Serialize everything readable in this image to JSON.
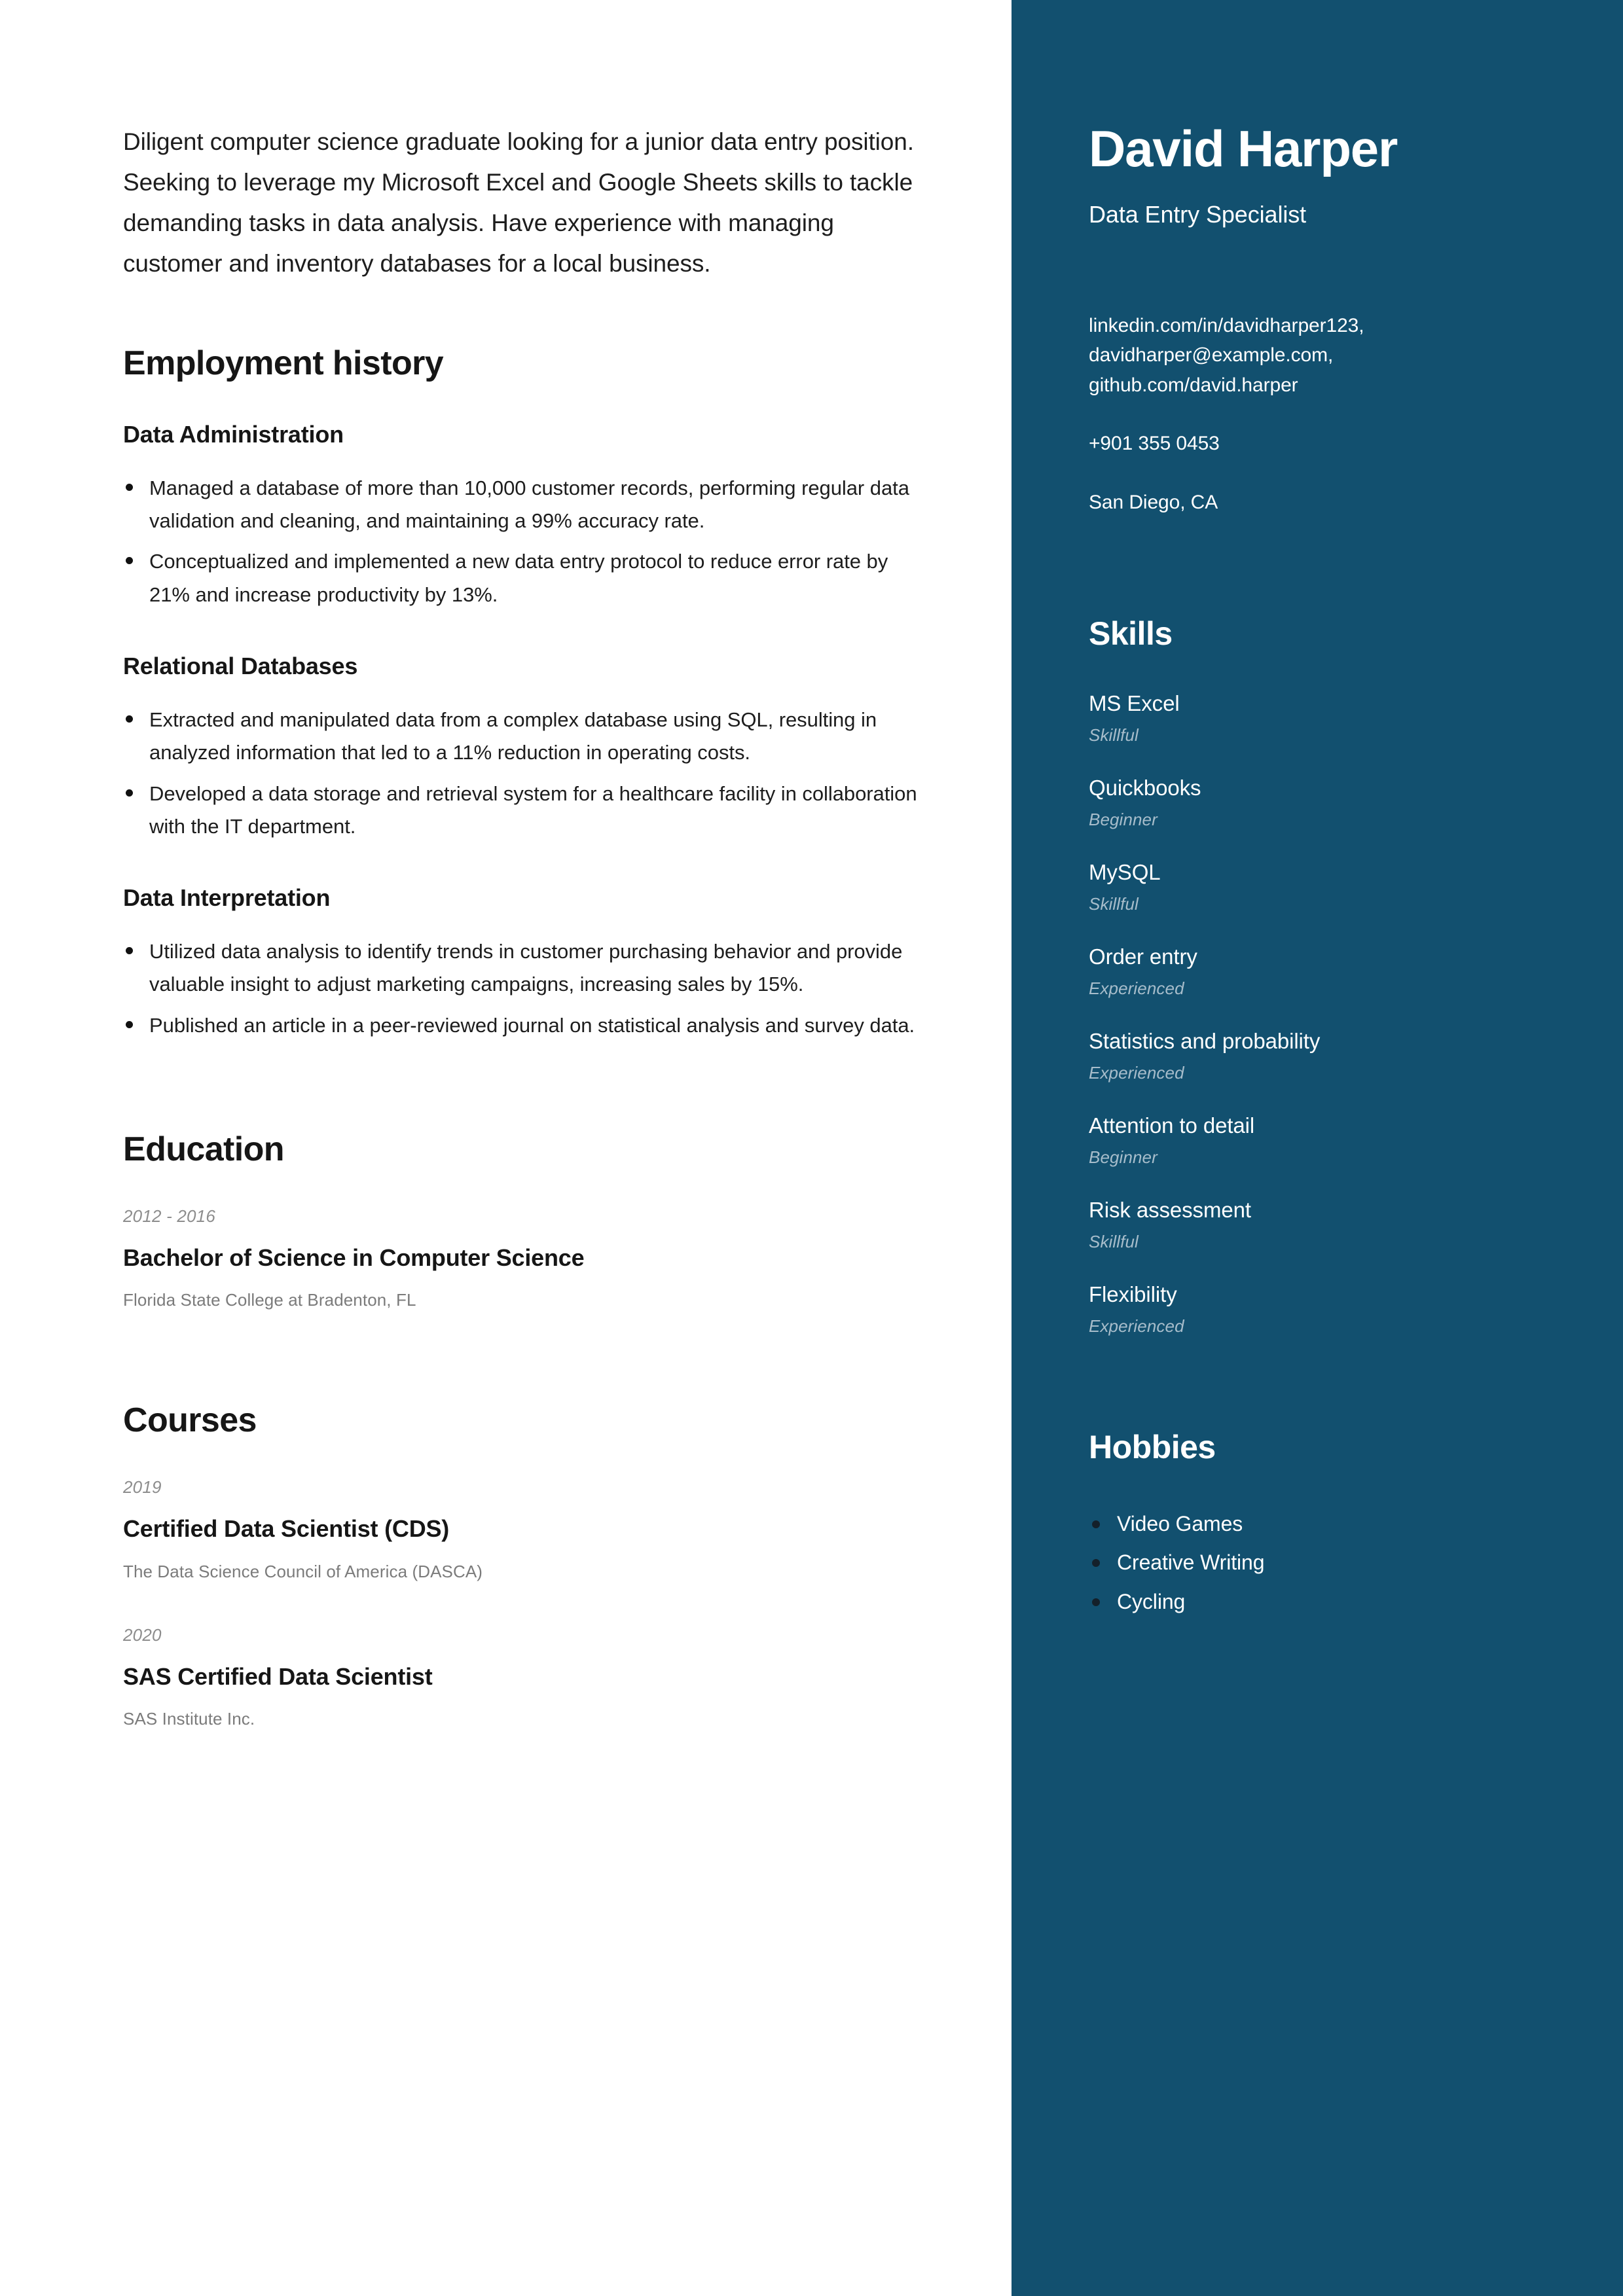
{
  "theme": {
    "sidebar_bg": "#12506f",
    "page_bg": "#ffffff",
    "heading_color": "#161616",
    "muted_text": "#7b7b7b",
    "date_text": "#8d8d8d",
    "skill_level_color": "#a7bdcb"
  },
  "header": {
    "name": "David Harper",
    "role": "Data Entry Specialist"
  },
  "contact": {
    "links": [
      "linkedin.com/in/davidharper123,",
      "davidharper@example.com,",
      "github.com/david.harper"
    ],
    "phone": "+901 355 0453",
    "location": "San Diego, CA"
  },
  "summary": "Diligent computer science graduate looking for a junior data entry position. Seeking to leverage my Microsoft Excel and Google Sheets skills to tackle demanding tasks in data analysis. Have experience with managing customer and inventory databases for a local business.",
  "employment": {
    "heading": "Employment history",
    "jobs": [
      {
        "title": "Data Administration",
        "bullets": [
          "Managed a database of more than 10,000 customer records, performing regular data validation and cleaning, and maintaining a 99% accuracy rate.",
          "Conceptualized and implemented a new data entry protocol to reduce error rate by 21% and increase productivity by 13%."
        ]
      },
      {
        "title": "Relational Databases",
        "bullets": [
          "Extracted and manipulated data from a complex database using SQL, resulting in analyzed information that led to a 11% reduction in operating costs.",
          "Developed a data storage and retrieval system for a healthcare facility in collaboration with the IT department."
        ]
      },
      {
        "title": "Data Interpretation",
        "bullets": [
          "Utilized data analysis to identify trends in customer purchasing behavior and provide valuable insight to adjust marketing campaigns, increasing sales by 15%.",
          "Published an article in a peer-reviewed journal on statistical analysis and survey data."
        ]
      }
    ]
  },
  "education": {
    "heading": "Education",
    "entries": [
      {
        "date": "2012 - 2016",
        "title": "Bachelor of Science in Computer Science",
        "org": "Florida State College at Bradenton, FL"
      }
    ]
  },
  "courses": {
    "heading": "Courses",
    "entries": [
      {
        "date": "2019",
        "title": "Certified Data Scientist (CDS)",
        "org": "The Data Science Council of America (DASCA)"
      },
      {
        "date": "2020",
        "title": "SAS Certified Data Scientist",
        "org": "SAS Institute Inc."
      }
    ]
  },
  "skills": {
    "heading": "Skills",
    "items": [
      {
        "name": "MS Excel",
        "level": "Skillful"
      },
      {
        "name": "Quickbooks",
        "level": "Beginner"
      },
      {
        "name": "MySQL",
        "level": "Skillful"
      },
      {
        "name": "Order entry",
        "level": "Experienced"
      },
      {
        "name": "Statistics and probability",
        "level": "Experienced"
      },
      {
        "name": "Attention to detail",
        "level": "Beginner"
      },
      {
        "name": "Risk assessment",
        "level": "Skillful"
      },
      {
        "name": "Flexibility",
        "level": "Experienced"
      }
    ]
  },
  "hobbies": {
    "heading": "Hobbies",
    "items": [
      "Video Games",
      "Creative Writing",
      "Cycling"
    ]
  }
}
